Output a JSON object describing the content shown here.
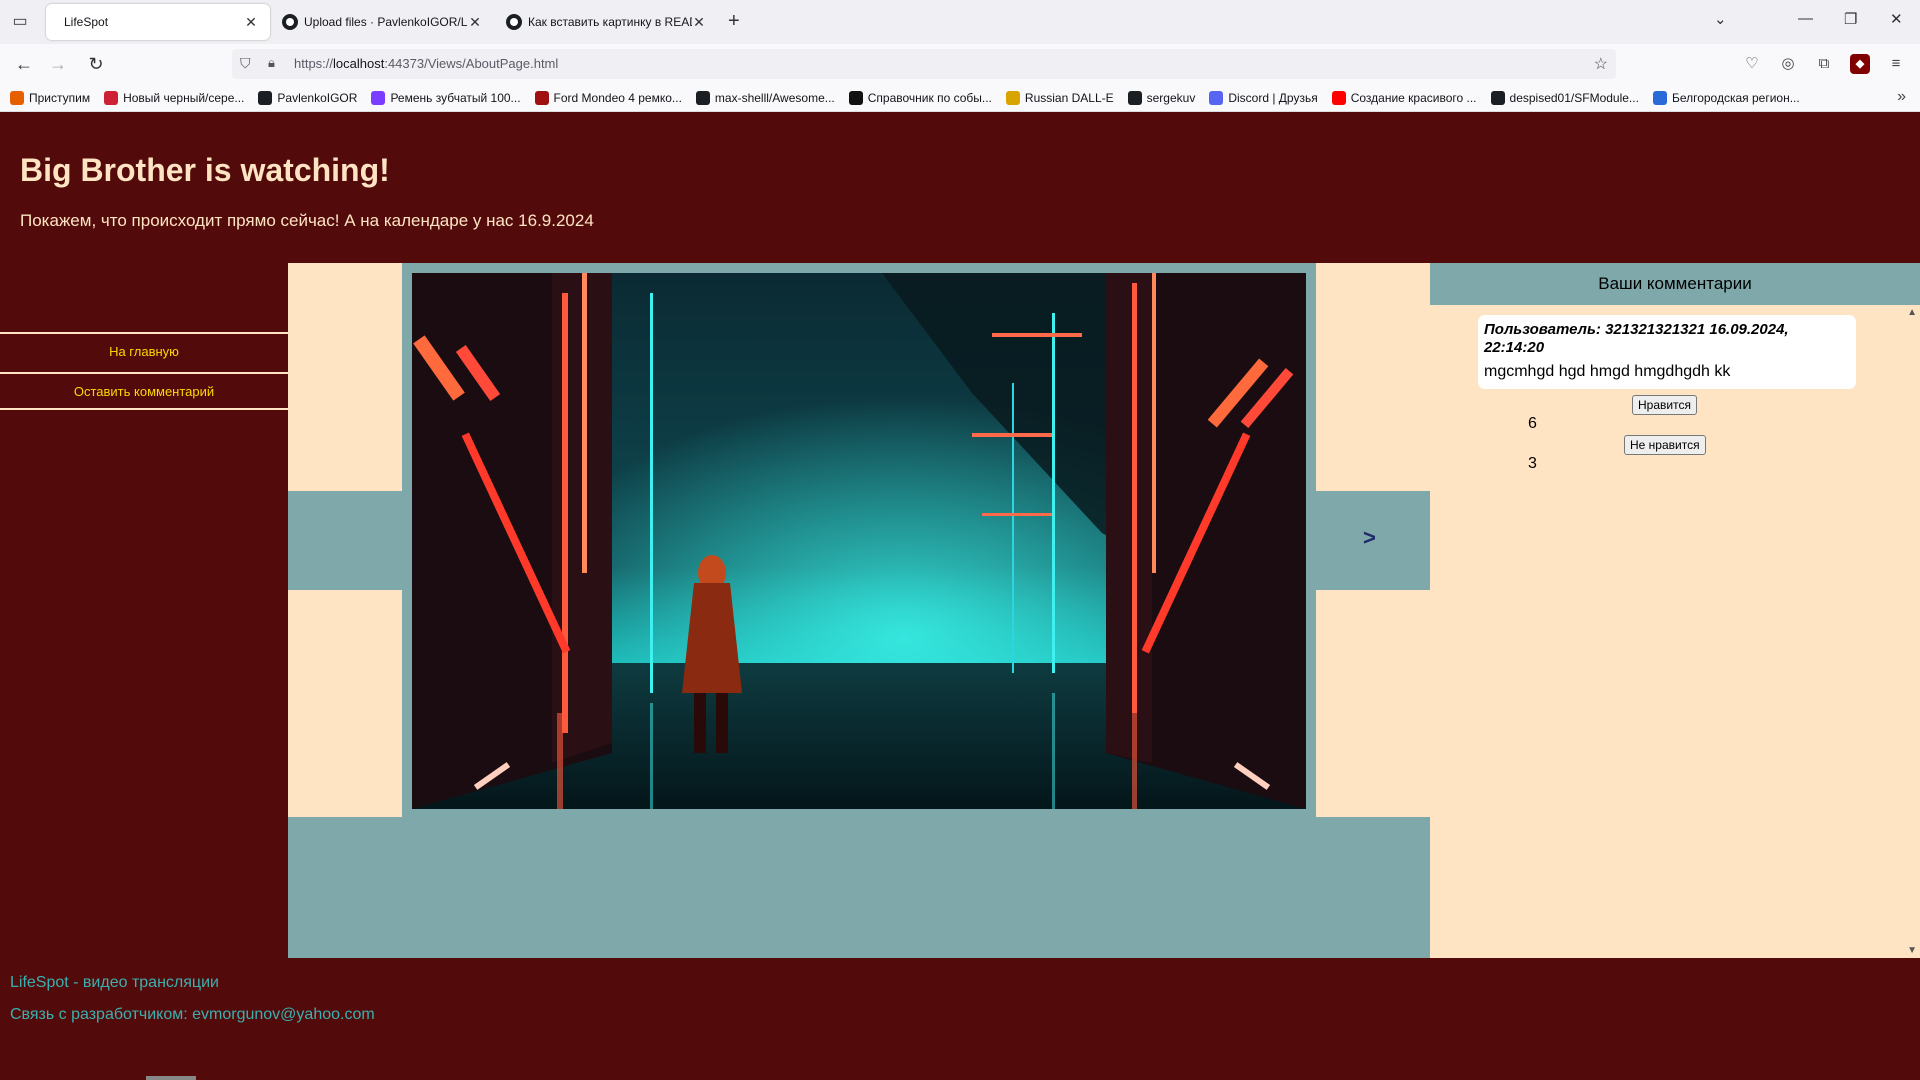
{
  "browser": {
    "tabs": [
      {
        "title": "LifeSpot",
        "active": true
      },
      {
        "title": "Upload files · PavlenkoIGOR/Lif",
        "active": false
      },
      {
        "title": "Как вставить картинку в READI",
        "active": false
      }
    ],
    "url_prefix": "https://",
    "url_host": "localhost",
    "url_rest": ":44373/Views/AboutPage.html",
    "bookmarks": [
      {
        "label": "Приступим",
        "color": "#e66000"
      },
      {
        "label": "Новый черный/сере...",
        "color": "#cc2233"
      },
      {
        "label": "PavlenkoIGOR",
        "color": "#1b1f23"
      },
      {
        "label": "Ремень зубчатый 100...",
        "color": "#7a3cff"
      },
      {
        "label": "Ford Mondeo 4 ремко...",
        "color": "#a01010"
      },
      {
        "label": "max-shelll/Awesome...",
        "color": "#1b1f23"
      },
      {
        "label": "Справочник по собы...",
        "color": "#111111"
      },
      {
        "label": "Russian DALL-E",
        "color": "#d9a300"
      },
      {
        "label": "sergekuv",
        "color": "#1b1f23"
      },
      {
        "label": "Discord | Друзья",
        "color": "#5865f2"
      },
      {
        "label": "Создание красивого ...",
        "color": "#ff0000"
      },
      {
        "label": "despised01/SFModule...",
        "color": "#1b1f23"
      },
      {
        "label": "Белгородская регион...",
        "color": "#2a6ad8"
      }
    ]
  },
  "page": {
    "title": "Big Brother is watching!",
    "subtitle": "Покажем, что происходит прямо сейчас! А на календаре у нас 16.9.2024"
  },
  "sidebar": {
    "items": [
      {
        "label": "На главную"
      },
      {
        "label": "Оставить комментарий"
      }
    ]
  },
  "slider": {
    "next_label": ">"
  },
  "comments": {
    "header": "Ваши комментарии",
    "items": [
      {
        "author": "Пользователь: 321321321321 16.09.2024, 22:14:20",
        "text": "mgcmhgd hgd hmgd hmgdhgdh kk",
        "like_label": "Нравится",
        "likes": "6",
        "dislike_label": "Не нравится",
        "dislikes": "3"
      }
    ]
  },
  "footer": {
    "name": "LifeSpot - видео трансляции",
    "contact": "Связь с разработчиком: evmorgunov@yahoo.com"
  },
  "colors": {
    "page_bg": "#520A0A",
    "panel_bg": "#FFE4C4",
    "slate": "#7FA8AA",
    "link": "#FFD700",
    "footer_text": "#3CB0B0"
  }
}
